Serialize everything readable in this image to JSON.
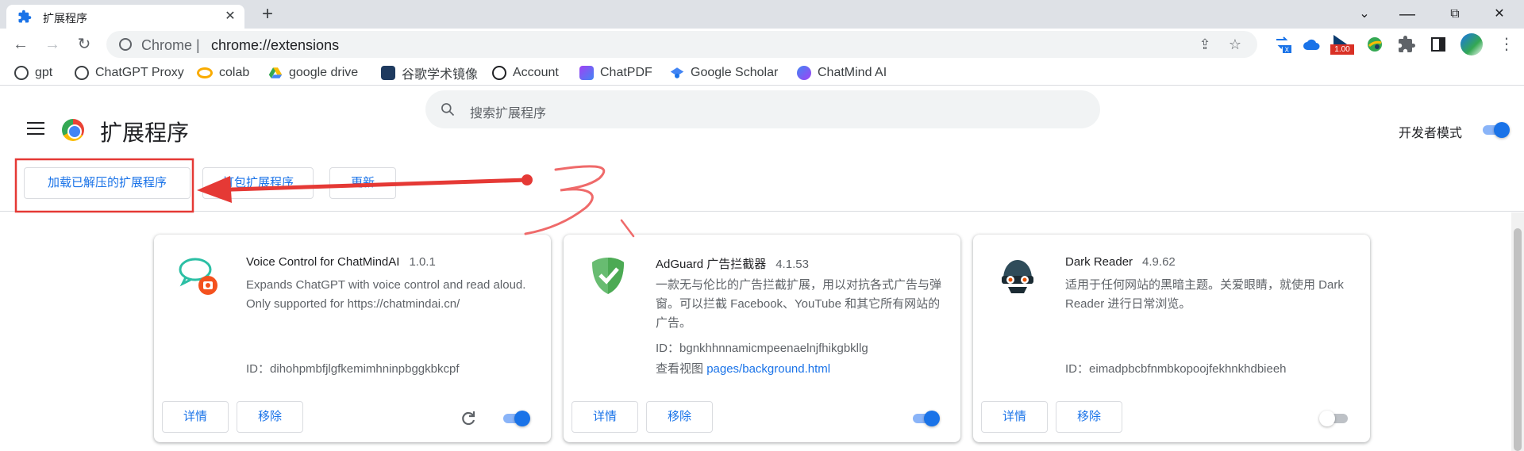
{
  "tab": {
    "title": "扩展程序",
    "close": "✕",
    "new_tab": "+"
  },
  "window": {
    "minimize": "⌄",
    "restore": "▢",
    "maximize": "⧉",
    "close": "✕"
  },
  "toolbar": {
    "scheme": "Chrome |",
    "url": "chrome://extensions",
    "badge_value": "1.00"
  },
  "bookmarks": [
    {
      "label": "gpt",
      "color": "#3c4043"
    },
    {
      "label": "ChatGPT Proxy",
      "color": "#3c4043"
    },
    {
      "label": "colab",
      "color": "#f9ab00"
    },
    {
      "label": "google drive",
      "color": "#34a853"
    },
    {
      "label": "谷歌学术镜像",
      "color": "#1e3a5f"
    },
    {
      "label": "Account",
      "color": "#202124"
    },
    {
      "label": "ChatPDF",
      "color": "#a142f4"
    },
    {
      "label": "Google Scholar",
      "color": "#4285f4"
    },
    {
      "label": "ChatMind AI",
      "color": "#1a73e8"
    }
  ],
  "header": {
    "title": "扩展程序",
    "search_placeholder": "搜索扩展程序",
    "dev_mode_label": "开发者模式",
    "dev_mode_on": true
  },
  "actions": {
    "load_unpacked": "加载已解压的扩展程序",
    "pack": "打包扩展程序",
    "update": "更新"
  },
  "annotation": {
    "label": "3",
    "color": "#e53935"
  },
  "extensions": [
    {
      "name": "Voice Control for ChatMindAI",
      "version": "1.0.1",
      "description": "Expands ChatGPT with voice control and read aloud. Only supported for https://chatmindai.cn/",
      "id_label": "ID：",
      "id": "dihohpmbfjlgfkemimhninpbggkbkcpf",
      "details": "详情",
      "remove": "移除",
      "enabled": true
    },
    {
      "name": "AdGuard 广告拦截器",
      "version": "4.1.53",
      "description": "一款无与伦比的广告拦截扩展，用以对抗各式广告与弹窗。可以拦截 Facebook、YouTube 和其它所有网站的广告。",
      "id_label": "ID：",
      "id": "bgnkhhnnamicmpeenaelnjfhikgbkllg",
      "view_label": "查看视图",
      "view_link": "pages/background.html",
      "details": "详情",
      "remove": "移除",
      "enabled": true
    },
    {
      "name": "Dark Reader",
      "version": "4.9.62",
      "description": "适用于任何网站的黑暗主题。关爱眼睛，就使用 Dark Reader 进行日常浏览。",
      "id_label": "ID：",
      "id": "eimadpbcbfnmbkopoojfekhnkhdbieeh",
      "details": "详情",
      "remove": "移除",
      "enabled": false
    }
  ]
}
